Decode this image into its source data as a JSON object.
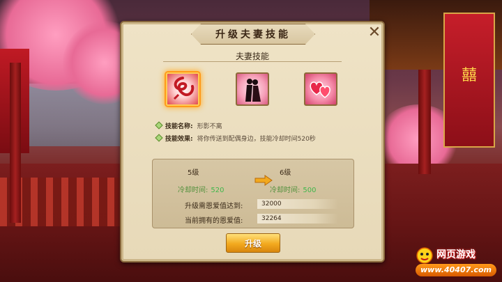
{
  "dialog": {
    "title": "升级夫妻技能",
    "section_title": "夫妻技能"
  },
  "skills": [
    {
      "icon": "swirl-skill-icon",
      "selected": true
    },
    {
      "icon": "couple-embrace-skill-icon",
      "selected": false
    },
    {
      "icon": "twin-hearts-skill-icon",
      "selected": false
    }
  ],
  "skill_info": {
    "name_key": "技能名称:",
    "name_value": "形影不离",
    "effect_key": "技能效果:",
    "effect_value": "将你传送到配偶身边，技能冷却时间520秒"
  },
  "upgrade": {
    "current_level": "5级",
    "next_level": "6级",
    "cooldown_label": "冷却时间:",
    "current_cooldown": "520",
    "next_cooldown": "500",
    "required_label": "升级需恩爱值达到:",
    "required_value": "32000",
    "owned_label": "当前拥有的恩爱值:",
    "owned_value": "32264",
    "button_label": "升级"
  },
  "scene": {
    "banner_text": "囍"
  },
  "watermark": {
    "title": "网页游戏",
    "url": "www.40407.com"
  },
  "colors": {
    "accent": "#f2a91e",
    "cooldown_green": "#3fb64a",
    "panel_bg": "#e7d9b8"
  }
}
